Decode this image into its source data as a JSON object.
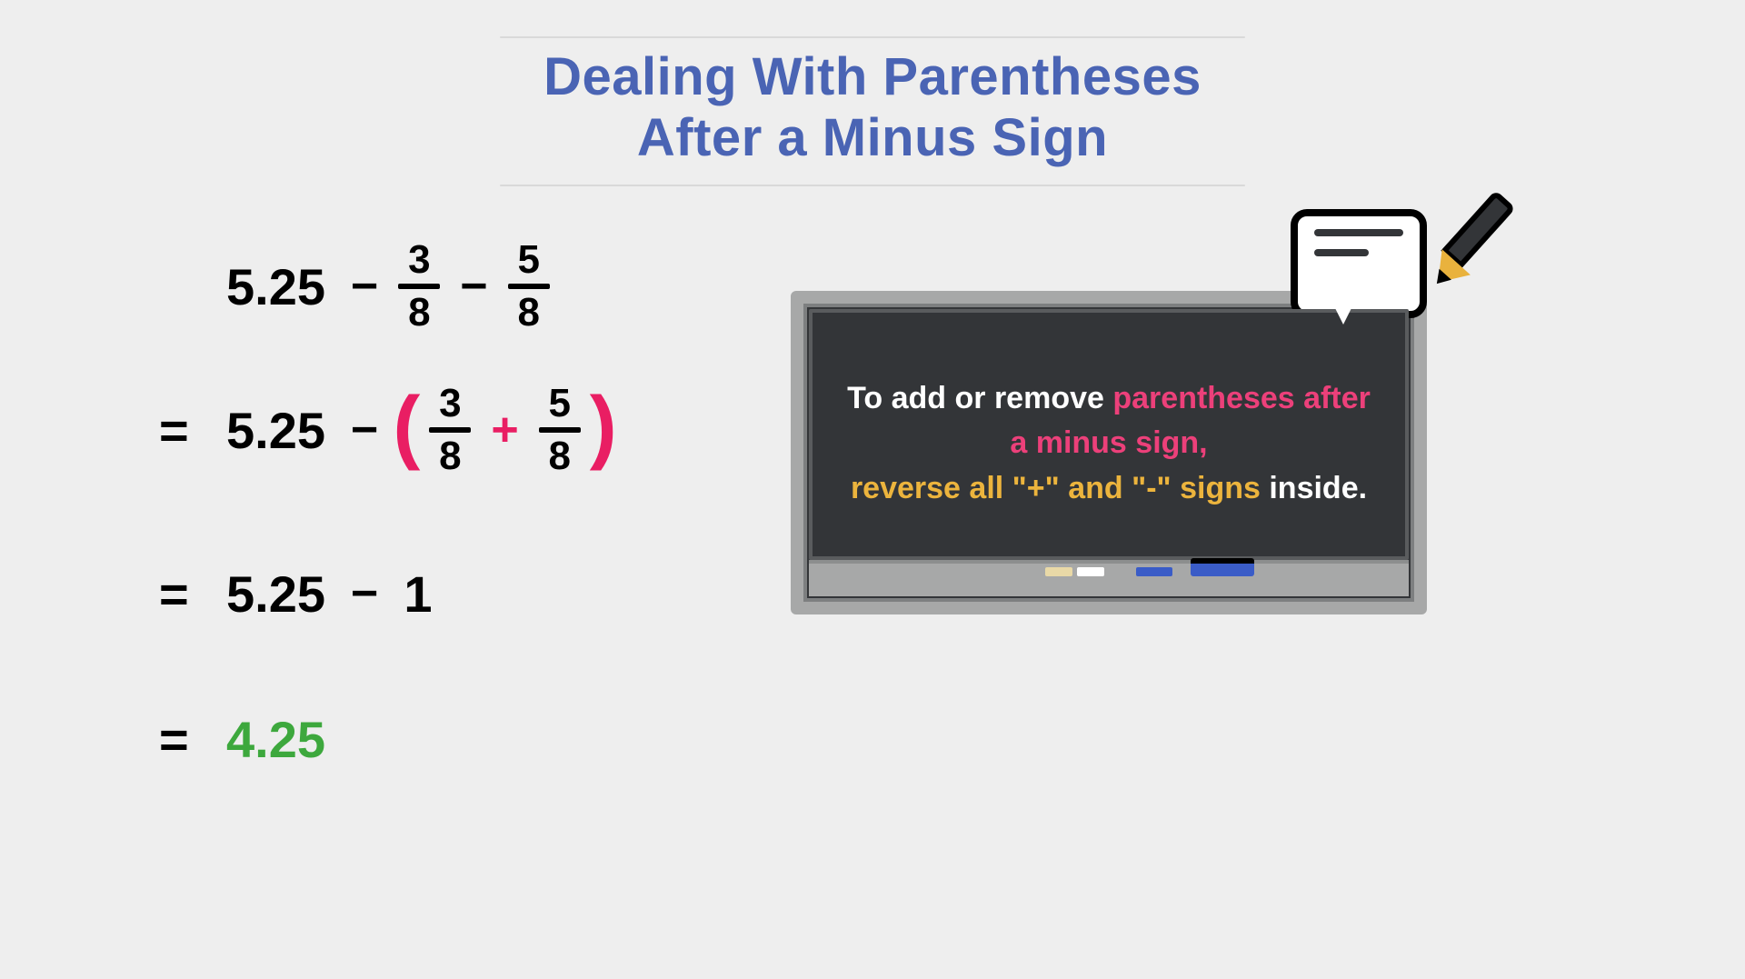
{
  "title": {
    "line1": "Dealing With Parentheses",
    "line2": "After a Minus Sign"
  },
  "math": {
    "base": "5.25",
    "minus": "−",
    "plus": "+",
    "equals": "=",
    "lparen": "(",
    "rparen": ")",
    "frac1": {
      "num": "3",
      "den": "8"
    },
    "frac2": {
      "num": "5",
      "den": "8"
    },
    "step3_val": "1",
    "answer": "4.25"
  },
  "board": {
    "t1": "To add or remove ",
    "t2": "parentheses after a minus sign,",
    "t3": "reverse all \"+\" and \"-\" signs",
    "t4": " inside."
  }
}
